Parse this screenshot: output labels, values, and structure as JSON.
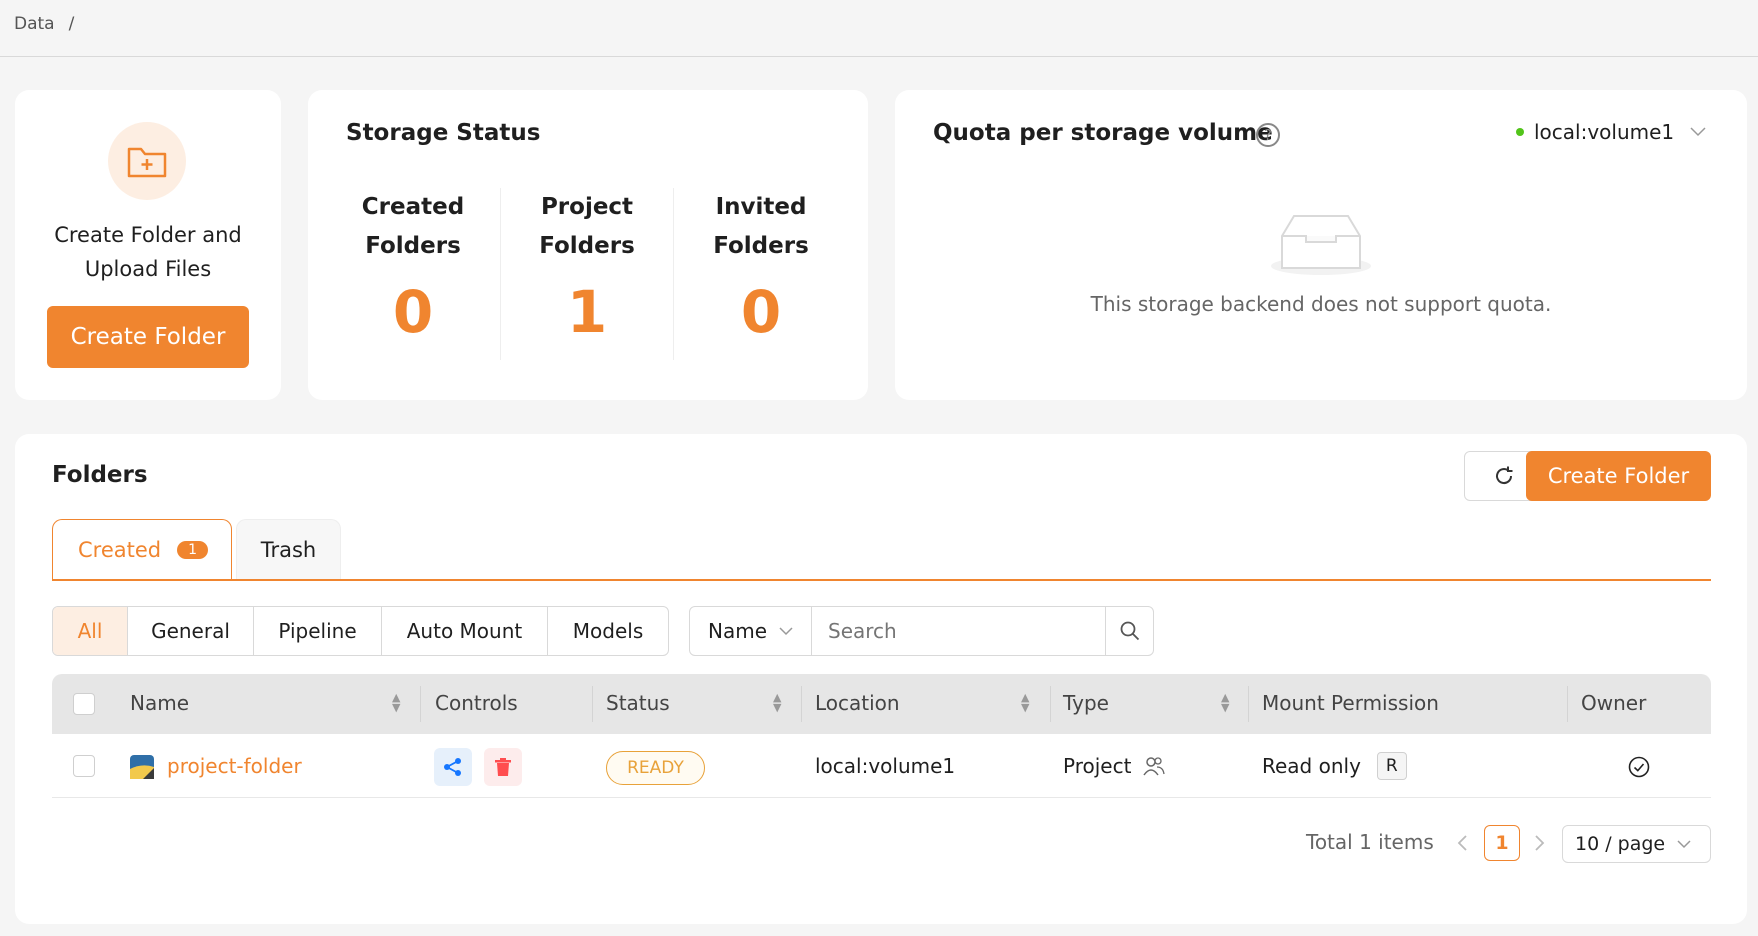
{
  "breadcrumb": {
    "root": "Data",
    "sep": "/"
  },
  "create_card": {
    "text_line1": "Create Folder and",
    "text_line2": "Upload Files",
    "button": "Create Folder"
  },
  "storage_status": {
    "title": "Storage Status",
    "stats": [
      {
        "label1": "Created",
        "label2": "Folders",
        "value": "0"
      },
      {
        "label1": "Project",
        "label2": "Folders",
        "value": "1"
      },
      {
        "label1": "Invited",
        "label2": "Folders",
        "value": "0"
      }
    ]
  },
  "quota": {
    "title": "Quota per storage volume",
    "volume": "local:volume1",
    "empty_text": "This storage backend does not support quota."
  },
  "folders": {
    "title": "Folders",
    "create_button": "Create Folder",
    "tabs": [
      {
        "label": "Created",
        "count": "1"
      },
      {
        "label": "Trash"
      }
    ],
    "filters": [
      "All",
      "General",
      "Pipeline",
      "Auto Mount",
      "Models"
    ],
    "search_field": "Name",
    "search_placeholder": "Search",
    "columns": [
      "Name",
      "Controls",
      "Status",
      "Location",
      "Type",
      "Mount Permission",
      "Owner"
    ],
    "rows": [
      {
        "name": "project-folder",
        "status": "READY",
        "location": "local:volume1",
        "type": "Project",
        "permission": "Read only",
        "perm_badge": "R"
      }
    ],
    "pagination": {
      "total": "Total 1 items",
      "page": "1",
      "page_size": "10 / page"
    }
  },
  "colors": {
    "accent": "#f0852f",
    "ready": "#e8a23a",
    "share": "#1677ff",
    "delete": "#ff4d4f",
    "online": "#52c41a"
  }
}
